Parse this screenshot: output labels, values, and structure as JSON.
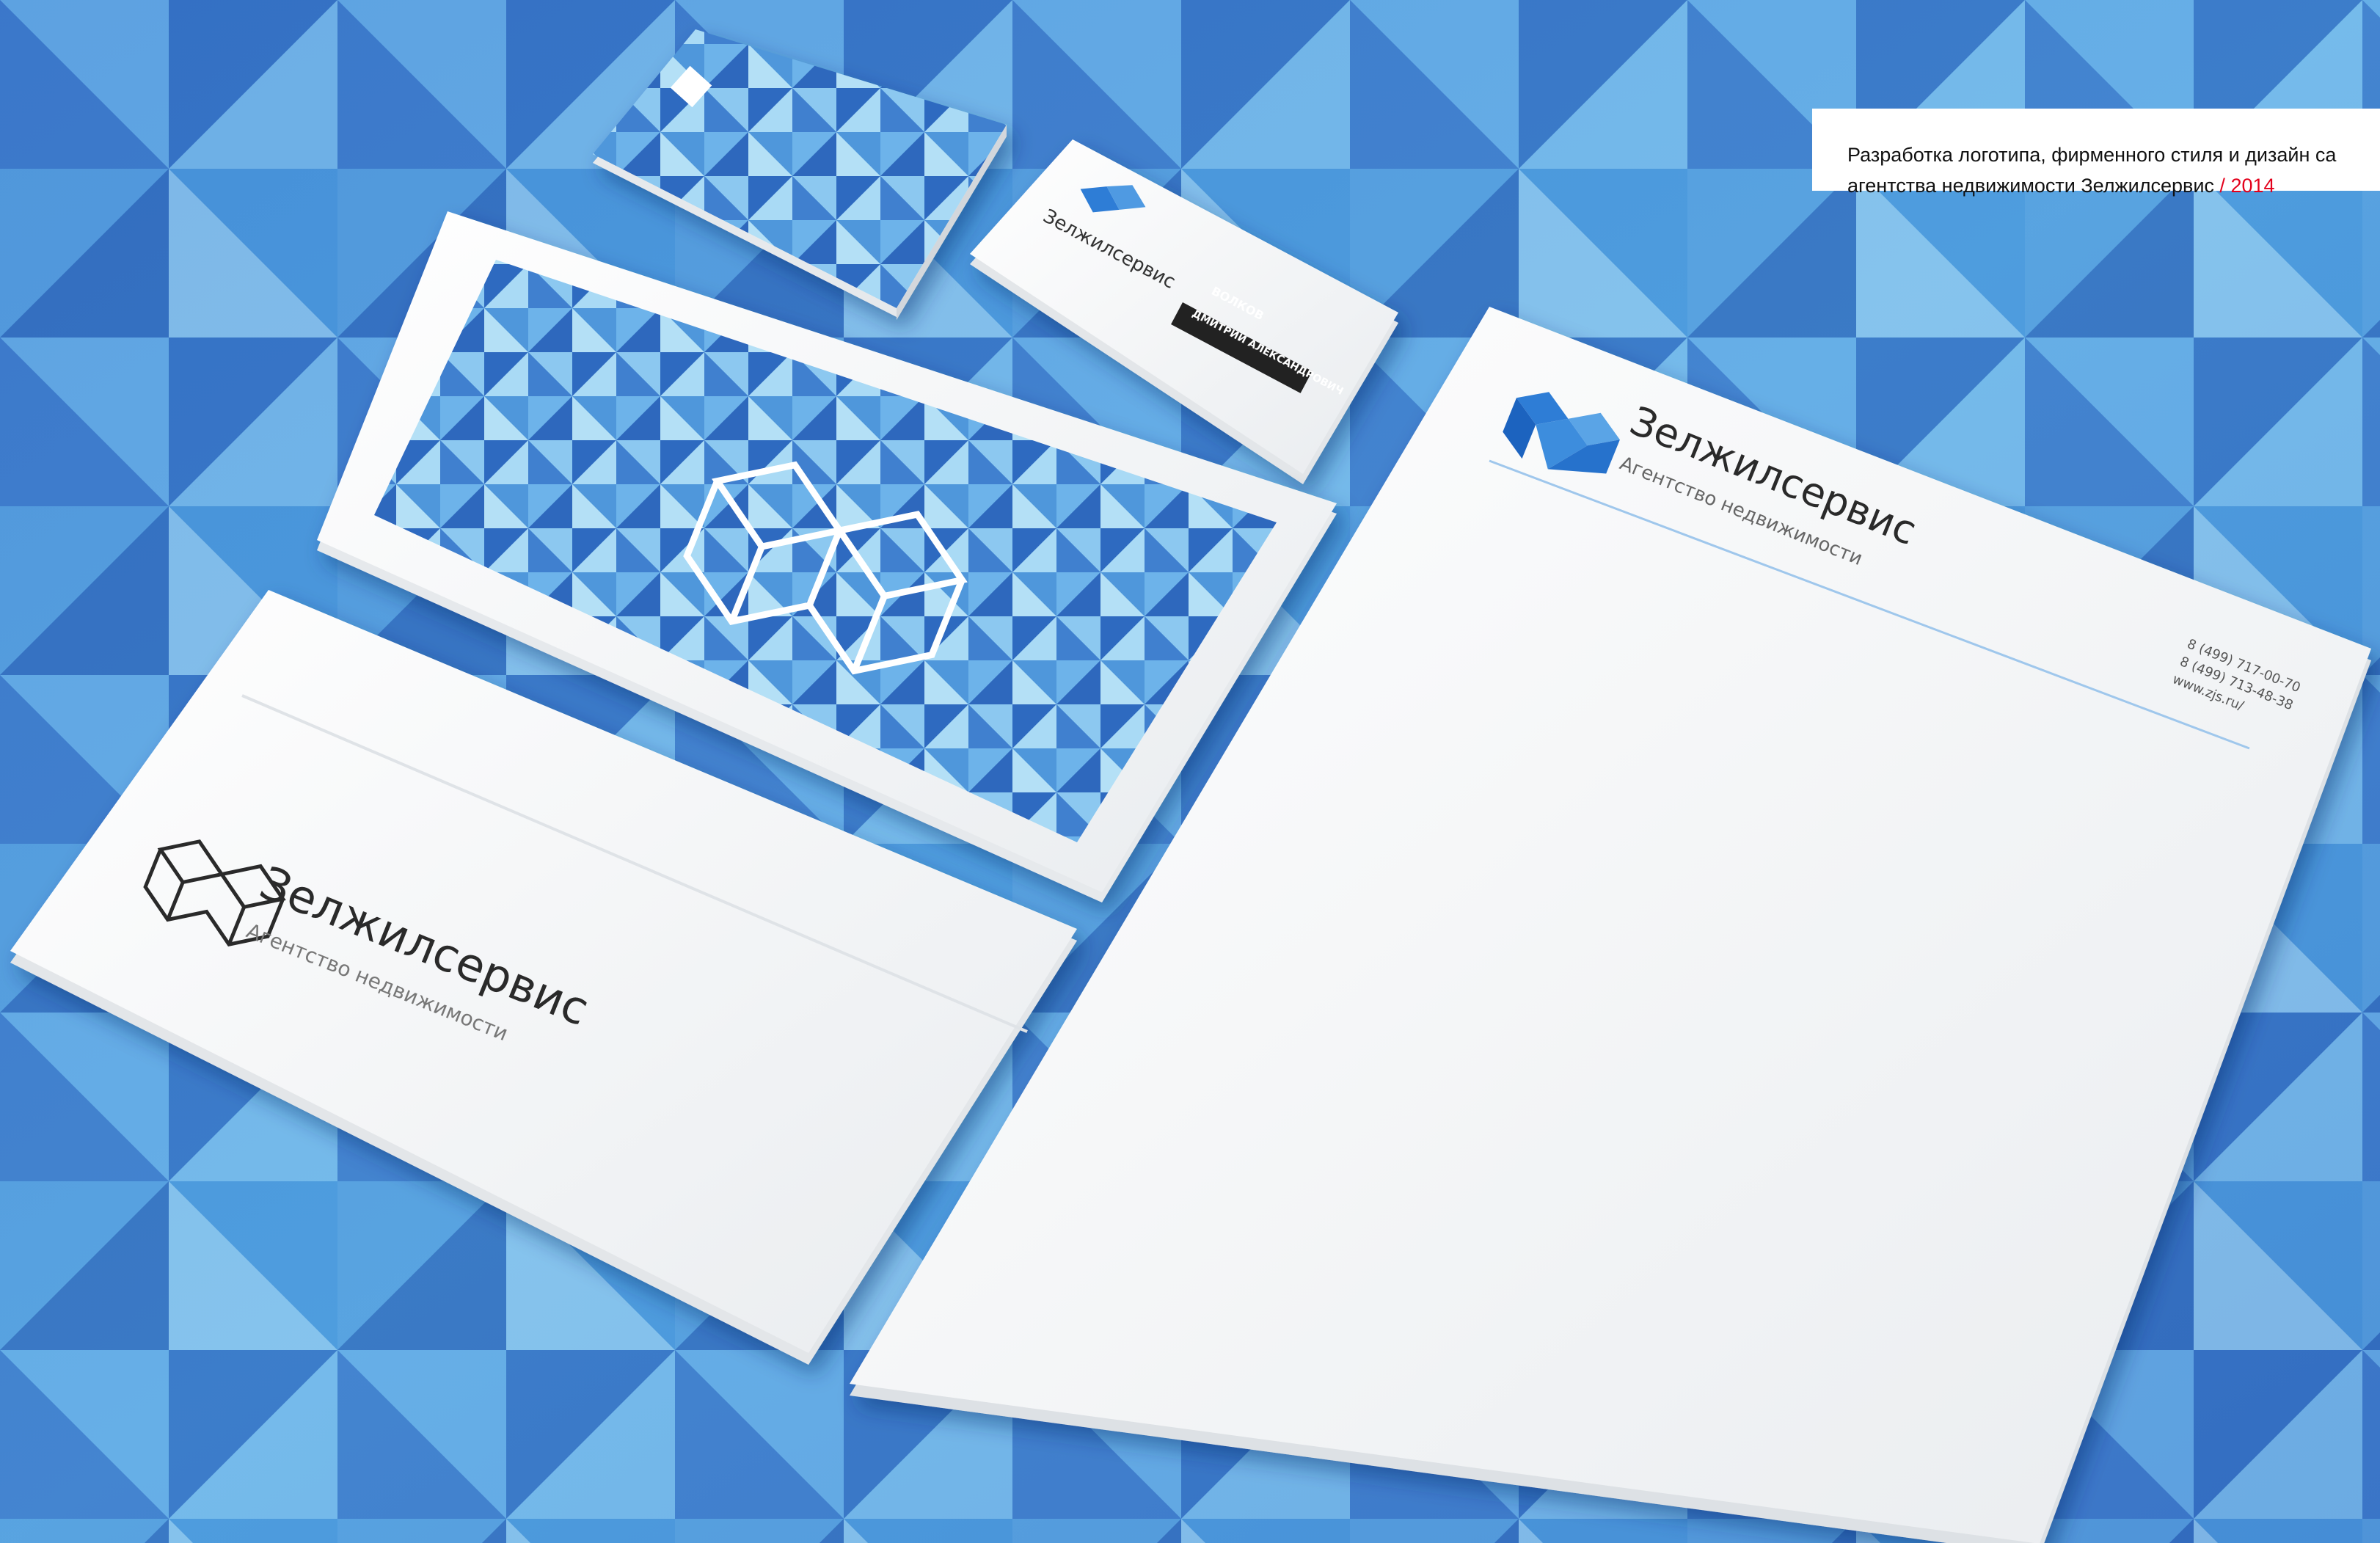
{
  "colors": {
    "background_blue": "#3f8bd3",
    "background_light": "#8fcaf0",
    "background_dark": "#2a5fb8",
    "paper": "#f7f8f9",
    "logo_blue": "#2f7dd6",
    "caption_accent": "#e3001b"
  },
  "caption": {
    "line1": "Разработка логотипа, фирменного стиля и дизайн са",
    "line2": "агентства недвижимости Зелжилсервис",
    "separator": " / ",
    "year": "2014"
  },
  "brand": {
    "name": "Зелжилсервис",
    "tagline": "Агентство недвижимости"
  },
  "letterhead": {
    "contacts": [
      "8 (499) 717-00-70",
      "8 (499) 713-48-38",
      "www.zjs.ru/"
    ]
  },
  "business_card": {
    "surname": "ВОЛКОВ",
    "full_name": "ДМИТРИЙ АЛЕКСАНДРОВИЧ"
  }
}
